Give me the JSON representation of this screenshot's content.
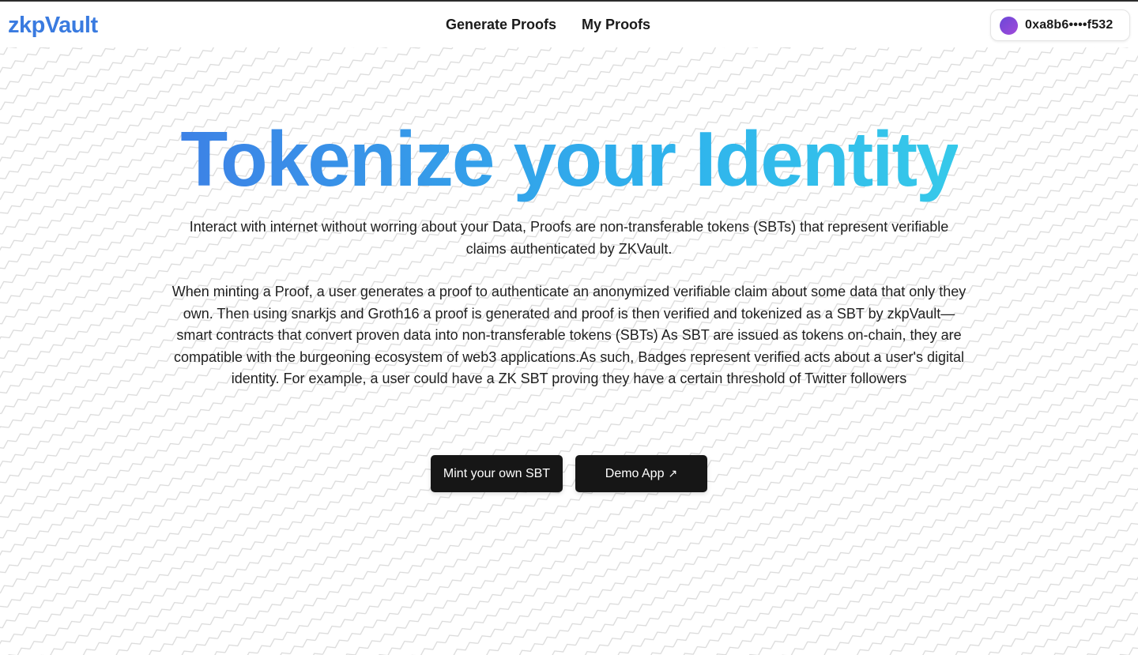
{
  "header": {
    "logo": "zkpVault",
    "nav": [
      {
        "label": "Generate Proofs"
      },
      {
        "label": "My Proofs"
      }
    ],
    "wallet": {
      "address": "0xa8b6••••f532",
      "avatar_gradient": [
        "#6a47d8",
        "#a24ad9"
      ]
    }
  },
  "hero": {
    "title": "Tokenize your Identity",
    "title_gradient": [
      "#3d82e6",
      "#36c9ea"
    ],
    "subtitle": "Interact with internet without worring about your Data, Proofs are non-transferable tokens (SBTs) that represent verifiable claims authenticated by ZKVault.",
    "body": "When minting a Proof, a user generates a proof to authenticate an anonymized verifiable claim about some data that only they own. Then using snarkjs and Groth16 a proof is generated and proof is then verified and tokenized as a SBT by zkpVault—smart contracts that convert proven data into non-transferable tokens (SBTs) As SBT are issued as tokens on-chain, they are compatible with the burgeoning ecosystem of web3 applications.As such, Badges represent verified acts about a user's digital identity. For example, a user could have a ZK SBT proving they have a certain threshold of Twitter followers"
  },
  "actions": {
    "mint_label": "Mint your own SBT",
    "demo_label": "Demo App",
    "demo_icon": "external-link-arrow-icon"
  },
  "colors": {
    "logo": "#3a7be0",
    "button_bg": "#161616",
    "button_text": "#ffffff",
    "pattern_line": "#d6d6d6"
  }
}
